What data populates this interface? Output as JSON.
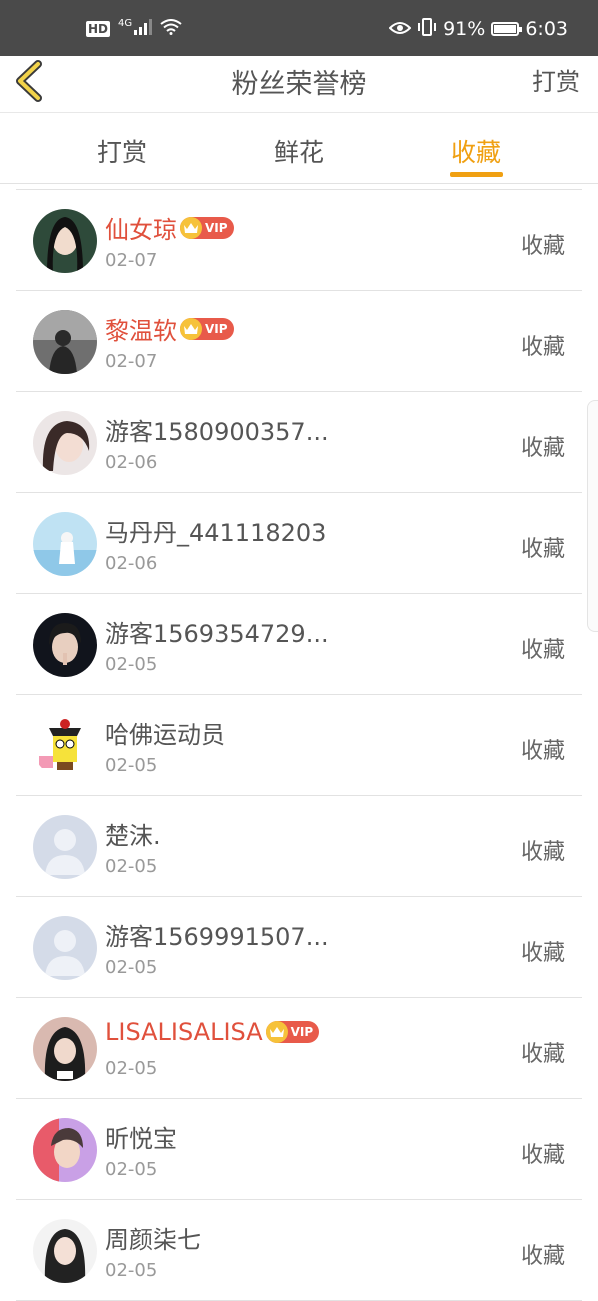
{
  "status_bar": {
    "hd": "HD",
    "network": "4G",
    "battery_text": "91%",
    "battery_level": 0.91,
    "time": "6:03"
  },
  "header": {
    "title": "粉丝荣誉榜",
    "action_label": "打赏"
  },
  "tabs": [
    {
      "label": "打赏",
      "active": false
    },
    {
      "label": "鲜花",
      "active": false
    },
    {
      "label": "收藏",
      "active": true
    }
  ],
  "colors": {
    "accent": "#f0a012",
    "vip_name": "#e0503c",
    "vip_badge": "#e85a4a"
  },
  "vip_label": "VIP",
  "list": [
    {
      "name": "仙女琼",
      "date": "02-07",
      "action": "收藏",
      "vip": true,
      "avatar": "photo-woman-avatar"
    },
    {
      "name": "黎温软",
      "date": "02-07",
      "action": "收藏",
      "vip": true,
      "avatar": "photo-dark-silhouette-avatar"
    },
    {
      "name": "游客1580900357...",
      "date": "02-06",
      "action": "收藏",
      "vip": false,
      "avatar": "photo-girl-avatar"
    },
    {
      "name": "马丹丹_441118203",
      "date": "02-06",
      "action": "收藏",
      "vip": false,
      "avatar": "photo-beach-avatar"
    },
    {
      "name": "游客1569354729...",
      "date": "02-05",
      "action": "收藏",
      "vip": false,
      "avatar": "photo-young-man-avatar"
    },
    {
      "name": "哈佛运动员",
      "date": "02-05",
      "action": "收藏",
      "vip": false,
      "avatar": "cartoon-sponge-avatar"
    },
    {
      "name": "楚沫.",
      "date": "02-05",
      "action": "收藏",
      "vip": false,
      "avatar": "default-user-avatar"
    },
    {
      "name": "游客1569991507...",
      "date": "02-05",
      "action": "收藏",
      "vip": false,
      "avatar": "default-user-avatar"
    },
    {
      "name": "LISALISALISA",
      "date": "02-05",
      "action": "收藏",
      "vip": true,
      "avatar": "photo-hooded-person-avatar"
    },
    {
      "name": "昕悦宝",
      "date": "02-05",
      "action": "收藏",
      "vip": false,
      "avatar": "photo-boy-avatar"
    },
    {
      "name": "周颜柒七",
      "date": "02-05",
      "action": "收藏",
      "vip": false,
      "avatar": "photo-long-hair-girl-avatar"
    }
  ]
}
